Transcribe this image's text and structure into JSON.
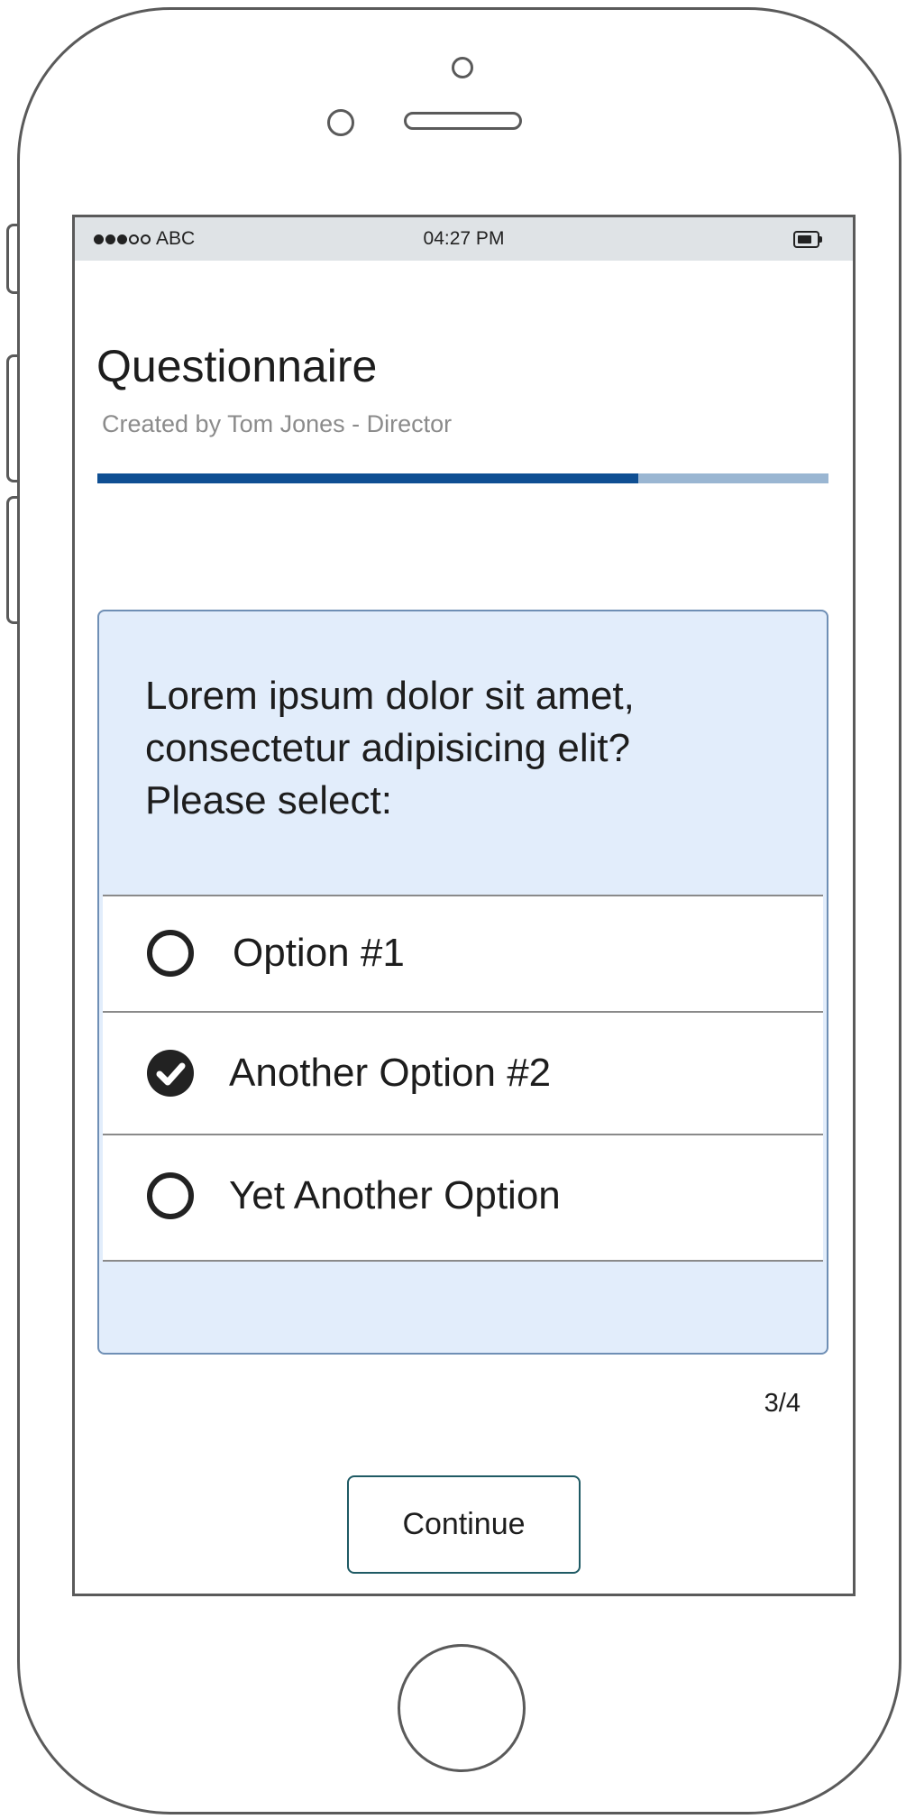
{
  "status_bar": {
    "signal_bars": 5,
    "signal_filled": 3,
    "carrier": "ABC",
    "time": "04:27 PM",
    "battery_level": 0.7
  },
  "header": {
    "title": "Questionnaire",
    "subtitle": "Created by Tom Jones - Director"
  },
  "progress": {
    "fraction": 0.74,
    "fill_color": "#0f4f93",
    "track_color": "#9ab6d2"
  },
  "question": {
    "text": "Lorem ipsum dolor sit amet,\nconsectetur adipisicing elit?\nPlease select:"
  },
  "options": [
    {
      "label": "Option #1",
      "selected": false
    },
    {
      "label": "Another Option #2",
      "selected": true
    },
    {
      "label": "Yet Another Option",
      "selected": false
    }
  ],
  "step_counter": "3/4",
  "continue_label": "Continue",
  "colors": {
    "card_background": "#e2edfb",
    "card_border": "#6f8fb5",
    "status_bar": "#dfe3e6"
  }
}
